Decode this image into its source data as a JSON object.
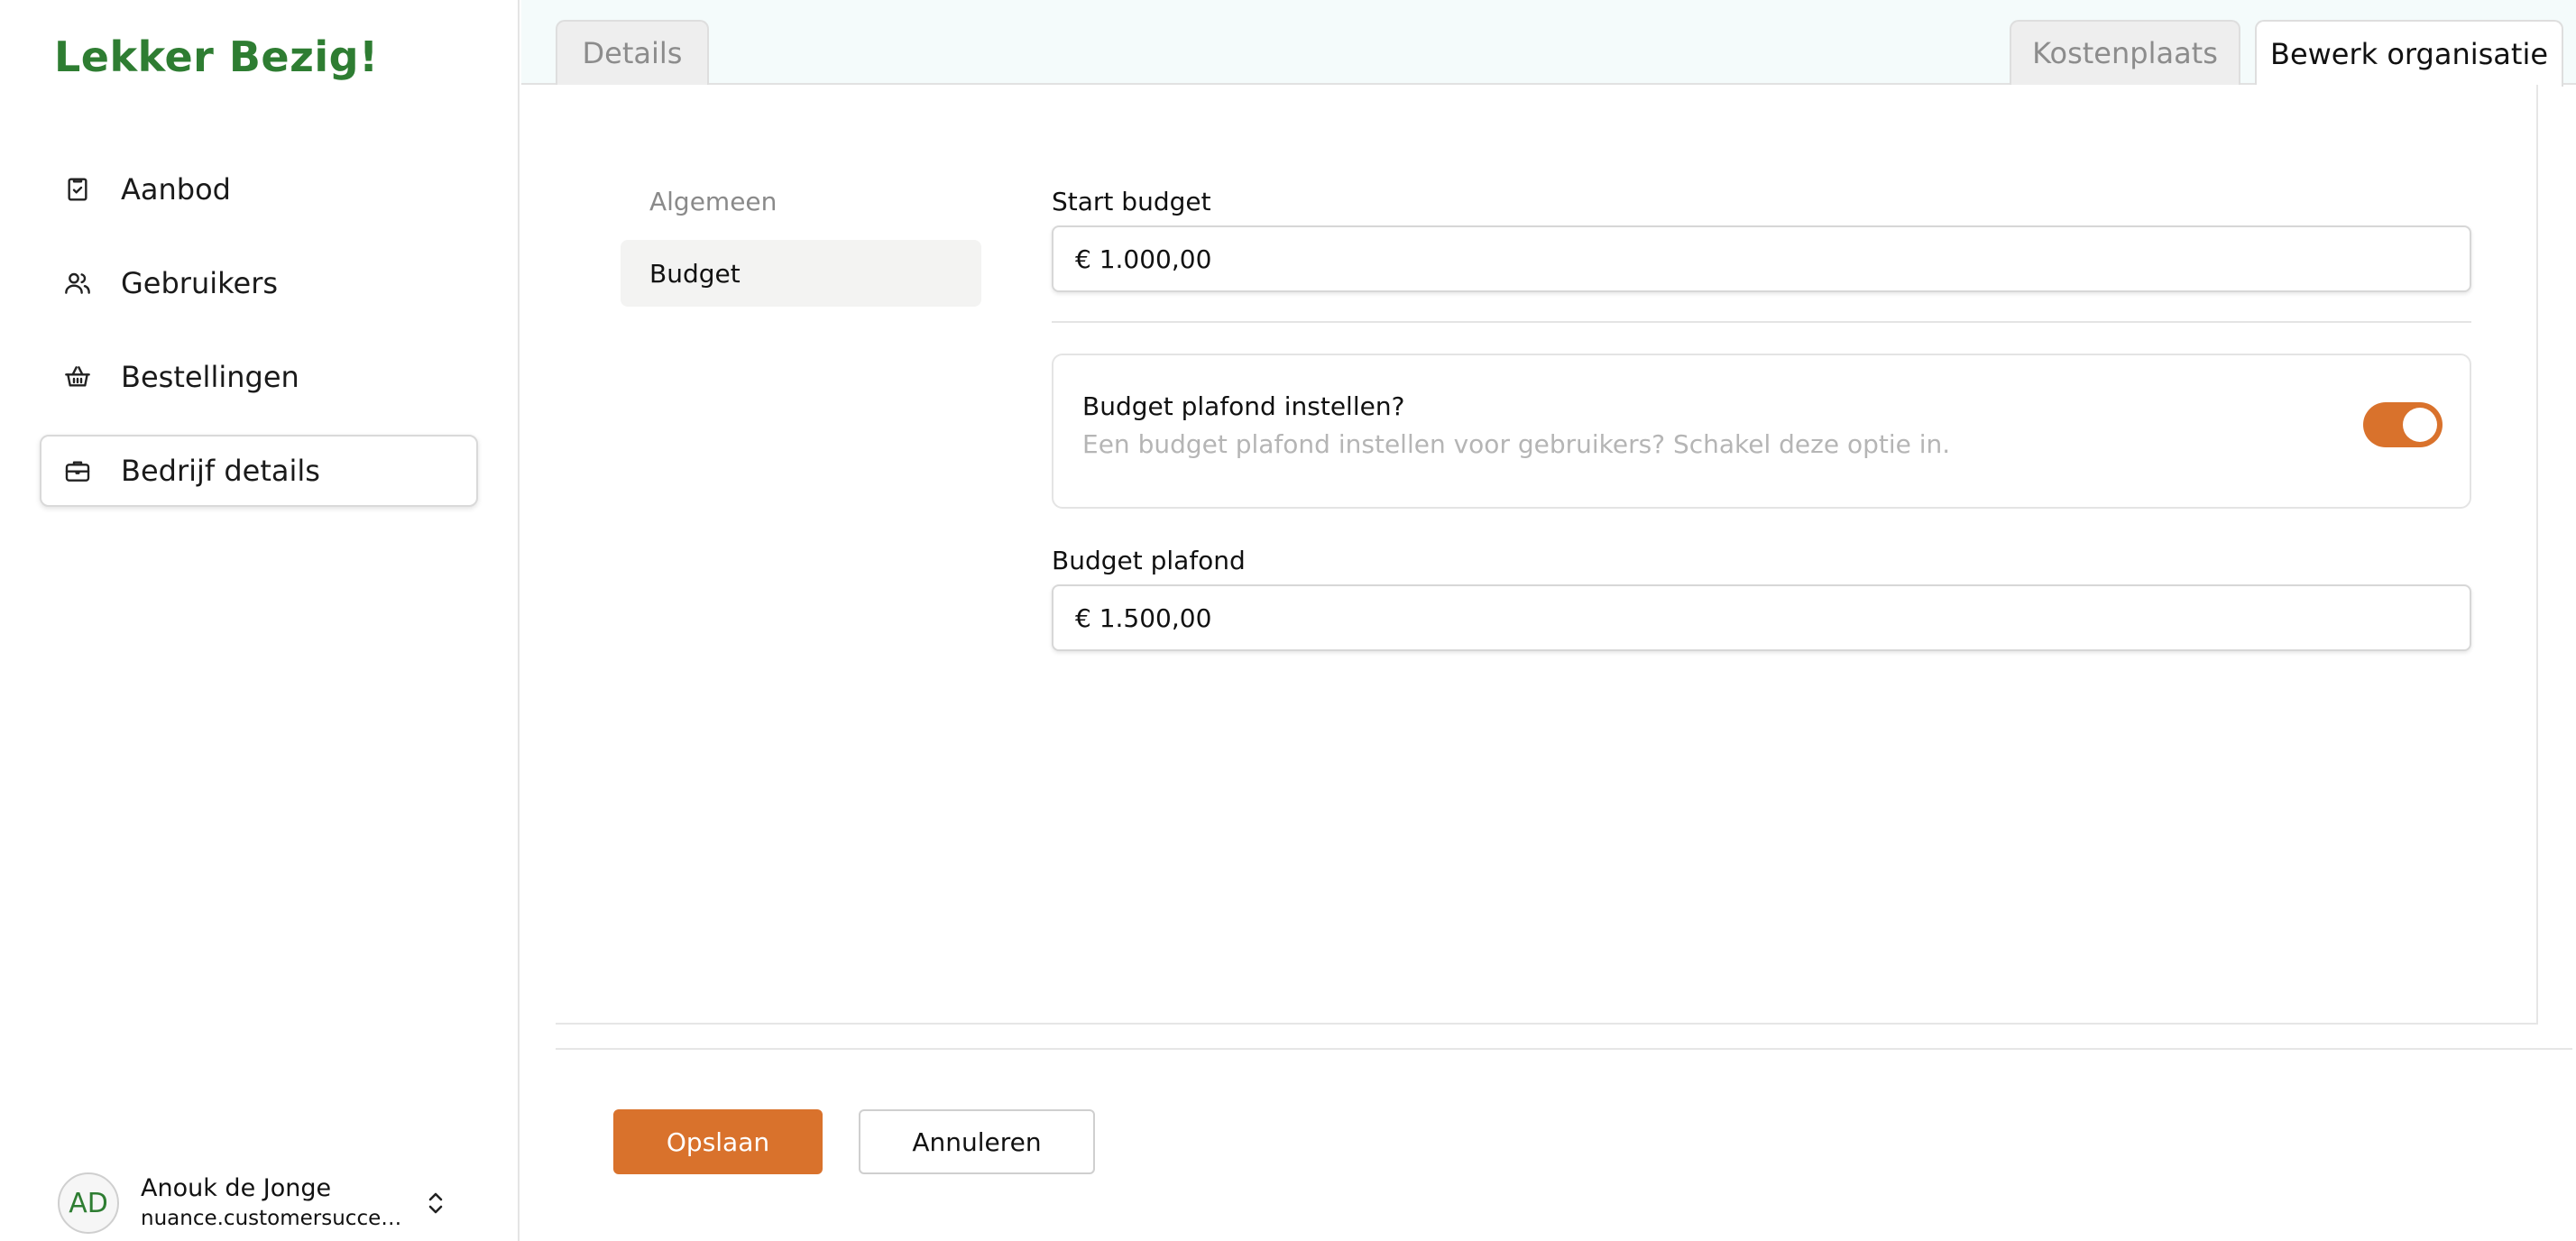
{
  "brand": {
    "name": "Lekker Bezig!"
  },
  "sidebar": {
    "items": [
      {
        "label": "Aanbod",
        "icon": "clipboard-check-icon",
        "active": false
      },
      {
        "label": "Gebruikers",
        "icon": "users-icon",
        "active": false
      },
      {
        "label": "Bestellingen",
        "icon": "basket-icon",
        "active": false
      },
      {
        "label": "Bedrijf details",
        "icon": "briefcase-icon",
        "active": true
      }
    ]
  },
  "user": {
    "initials": "AD",
    "name": "Anouk de Jonge",
    "email": "nuance.customersucces..."
  },
  "tabs": {
    "left": [
      {
        "label": "Details",
        "active": false
      }
    ],
    "right": [
      {
        "label": "Kostenplaats",
        "active": false
      },
      {
        "label": "Bewerk organisatie",
        "active": true
      }
    ]
  },
  "subnav": {
    "items": [
      {
        "label": "Algemeen",
        "active": false
      },
      {
        "label": "Budget",
        "active": true
      }
    ]
  },
  "form": {
    "start_budget": {
      "label": "Start budget",
      "value": "€ 1.000,00"
    },
    "cap_toggle": {
      "title": "Budget plafond instellen?",
      "description": "Een budget plafond instellen voor gebruikers? Schakel deze optie in.",
      "enabled": true
    },
    "budget_cap": {
      "label": "Budget plafond",
      "value": "€ 1.500,00"
    }
  },
  "actions": {
    "save_label": "Opslaan",
    "cancel_label": "Annuleren"
  },
  "colors": {
    "brand_green": "#2e7d32",
    "accent_orange": "#d9722c",
    "muted_text": "#b5b5b5"
  }
}
